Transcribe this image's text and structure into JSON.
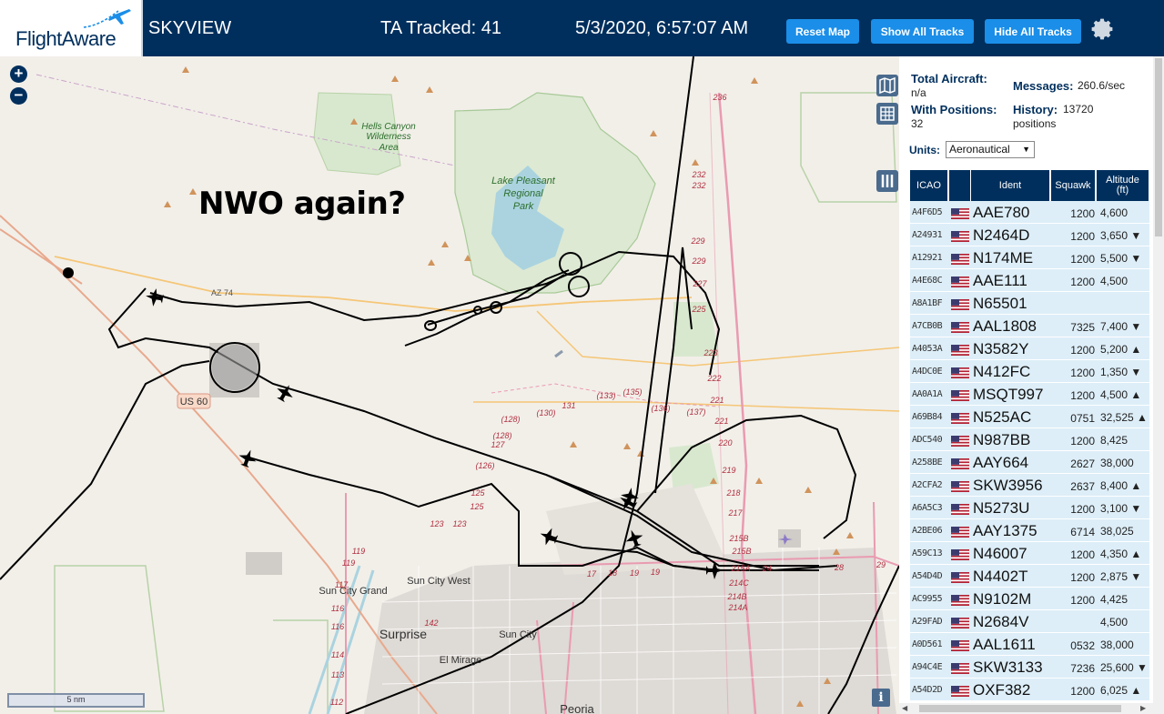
{
  "header": {
    "logo_text": "FlightAware",
    "app_title": "SKYVIEW",
    "tracked": "TA Tracked: 41",
    "clock": "5/3/2020, 6:57:07 AM",
    "buttons": [
      "Reset Map",
      "Show All Tracks",
      "Hide All Tracks"
    ],
    "gear_icon": "gear-icon",
    "accent_color": "#1a8ee8",
    "bar_color": "#002f5d"
  },
  "map": {
    "zoom_in": "+",
    "zoom_out": "−",
    "annotation": "NWO again?",
    "scale_label": "5 nm",
    "info_label": "i",
    "labels": {
      "hells_canyon": "Hells Canyon",
      "wilderness": "Wilderness",
      "area": "Area",
      "lake_pleasant": "Lake Pleasant",
      "regional": "Regional",
      "park": "Park",
      "us60": "US 60",
      "az74": "AZ 74",
      "sun_city_west": "Sun City West",
      "sun_city_grand": "Sun City Grand",
      "surprise": "Surprise",
      "sun_city": "Sun City",
      "el_mirage": "El Mirage",
      "peoria": "Peoria"
    },
    "route_numbers": {
      "r236": "236",
      "r232a": "232",
      "r232b": "232",
      "r229": "229",
      "r229b": "229",
      "r227": "227",
      "r225": "225",
      "r223": "223",
      "r222": "222",
      "r221a": "221",
      "r221b": "221",
      "r220": "220",
      "r219": "219",
      "r218": "218",
      "r217": "217",
      "r215b": "215B",
      "r215b2": "215B",
      "r215a": "215A",
      "r214c": "214C",
      "r214b": "214B",
      "r214a": "214A",
      "r133": "(133)",
      "r135": "(135)",
      "r136": "(136)",
      "r137": "(137)",
      "r131": "131",
      "r130": "(130)",
      "r128a": "(128)",
      "r128b": "(128)",
      "r127": "127",
      "r126": "(126)",
      "r125a": "125",
      "r125b": "125",
      "r123a": "123",
      "r123b": "123",
      "r119a": "119",
      "r119b": "119",
      "r117": "117",
      "r116a": "116",
      "r116b": "116",
      "r114": "114",
      "r113": "113",
      "r112": "112",
      "r142": "142",
      "r17": "17",
      "r18": "18",
      "r19a": "19",
      "r19b": "19",
      "r28": "28",
      "r29": "29",
      "r24": "24"
    }
  },
  "panel": {
    "total_aircraft_label": "Total Aircraft:",
    "total_aircraft_value": "n/a",
    "with_positions_label": "With Positions:",
    "with_positions_value": "32",
    "messages_label": "Messages:",
    "messages_value": "260.6/sec",
    "history_label": "History:",
    "history_value": "13720",
    "history_unit": "positions",
    "units_label": "Units:",
    "units_value": "Aeronautical",
    "columns": [
      "ICAO",
      "Ident",
      "Squawk",
      "Altitude (ft)"
    ],
    "rows": [
      {
        "icao": "A4F6D5",
        "ident": "AAE780",
        "squawk": "1200",
        "alt": "4,600"
      },
      {
        "icao": "A24931",
        "ident": "N2464D",
        "squawk": "1200",
        "alt": "3,650 ▼"
      },
      {
        "icao": "A12921",
        "ident": "N174ME",
        "squawk": "1200",
        "alt": "5,500 ▼"
      },
      {
        "icao": "A4E68C",
        "ident": "AAE111",
        "squawk": "1200",
        "alt": "4,500"
      },
      {
        "icao": "A8A1BF",
        "ident": "N65501",
        "squawk": "",
        "alt": ""
      },
      {
        "icao": "A7CB0B",
        "ident": "AAL1808",
        "squawk": "7325",
        "alt": "7,400 ▼"
      },
      {
        "icao": "A4053A",
        "ident": "N3582Y",
        "squawk": "1200",
        "alt": "5,200 ▲"
      },
      {
        "icao": "A4DC0E",
        "ident": "N412FC",
        "squawk": "1200",
        "alt": "1,350 ▼"
      },
      {
        "icao": "AA0A1A",
        "ident": "MSQT997",
        "squawk": "1200",
        "alt": "4,500 ▲"
      },
      {
        "icao": "A69B84",
        "ident": "N525AC",
        "squawk": "0751",
        "alt": "32,525 ▲"
      },
      {
        "icao": "ADC540",
        "ident": "N987BB",
        "squawk": "1200",
        "alt": "8,425"
      },
      {
        "icao": "A258BE",
        "ident": "AAY664",
        "squawk": "2627",
        "alt": "38,000"
      },
      {
        "icao": "A2CFA2",
        "ident": "SKW3956",
        "squawk": "2637",
        "alt": "8,400 ▲"
      },
      {
        "icao": "A6A5C3",
        "ident": "N5273U",
        "squawk": "1200",
        "alt": "3,100 ▼"
      },
      {
        "icao": "A2BE06",
        "ident": "AAY1375",
        "squawk": "6714",
        "alt": "38,025"
      },
      {
        "icao": "A59C13",
        "ident": "N46007",
        "squawk": "1200",
        "alt": "4,350 ▲"
      },
      {
        "icao": "A54D4D",
        "ident": "N4402T",
        "squawk": "1200",
        "alt": "2,875 ▼"
      },
      {
        "icao": "AC9955",
        "ident": "N9102M",
        "squawk": "1200",
        "alt": "4,425"
      },
      {
        "icao": "A29FAD",
        "ident": "N2684V",
        "squawk": "",
        "alt": "4,500"
      },
      {
        "icao": "A0D561",
        "ident": "AAL1611",
        "squawk": "0532",
        "alt": "38,000"
      },
      {
        "icao": "A94C4E",
        "ident": "SKW3133",
        "squawk": "7236",
        "alt": "25,600 ▼"
      },
      {
        "icao": "A54D2D",
        "ident": "OXF382",
        "squawk": "1200",
        "alt": "6,025 ▲"
      }
    ]
  }
}
